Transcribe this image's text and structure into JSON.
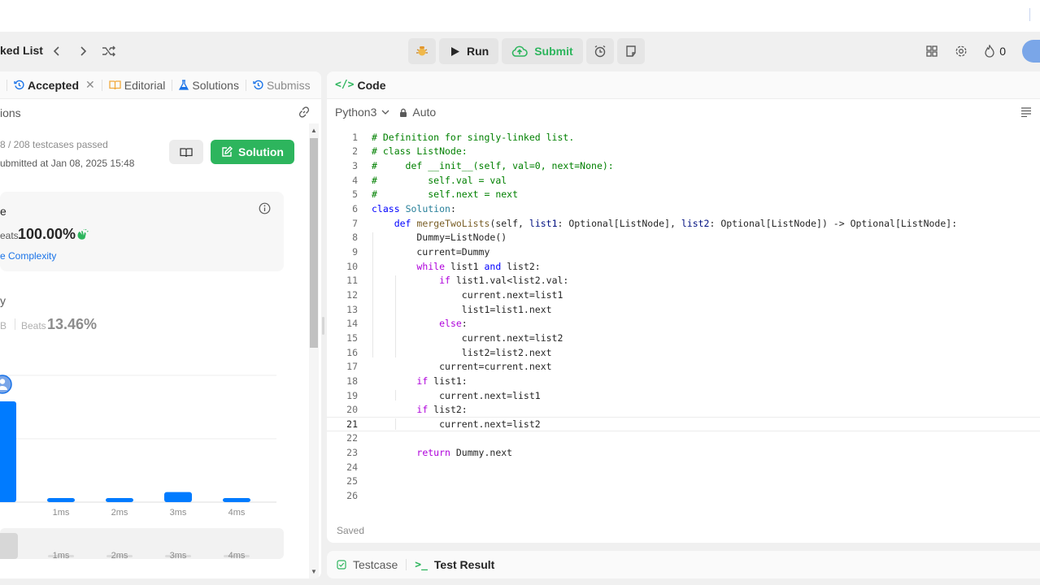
{
  "navbar": {
    "title_fragment": "ked List",
    "run_label": "Run",
    "submit_label": "Submit",
    "streak_count": "0"
  },
  "left_tabs": [
    {
      "label": "Accepted"
    },
    {
      "label": "Editorial"
    },
    {
      "label": "Solutions"
    },
    {
      "label": "Submiss"
    }
  ],
  "submission": {
    "heading_fragment": "ions",
    "testcases": "8 / 208 testcases passed",
    "submitted_at": "ubmitted at Jan 08, 2025 15:48",
    "solution_label": "Solution"
  },
  "runtime": {
    "label_fragment": "e",
    "beats_label": "eats",
    "beats_value": "100.00%",
    "complexity_link": "e Complexity"
  },
  "memory": {
    "label_fragment": "y",
    "unit_fragment": "B",
    "beats_label": "Beats",
    "beats_value": "13.46%"
  },
  "chart_data": {
    "type": "bar",
    "categories": [
      "",
      "1ms",
      "2ms",
      "3ms",
      "4ms"
    ],
    "values": [
      100,
      4,
      4,
      10,
      4
    ],
    "minimap_labels": [
      "1ms",
      "2ms",
      "3ms",
      "4ms"
    ],
    "bar_color": "#007bff"
  },
  "editor": {
    "header_label": "Code",
    "language": "Python3",
    "mode": "Auto",
    "saved_label": "Saved",
    "current_line": 21,
    "lines": [
      "# Definition for singly-linked list.",
      "# class ListNode:",
      "#     def __init__(self, val=0, next=None):",
      "#         self.val = val",
      "#         self.next = next",
      "class Solution:",
      "    def mergeTwoLists(self, list1: Optional[ListNode], list2: Optional[ListNode]) -> Optional[ListNode]:",
      "        Dummy=ListNode()",
      "        current=Dummy",
      "        while list1 and list2:",
      "            if list1.val<list2.val:",
      "                current.next=list1",
      "                list1=list1.next",
      "            else:",
      "                current.next=list2",
      "                list2=list2.next",
      "            current=current.next",
      "        if list1:",
      "            current.next=list1",
      "        if list2:",
      "            current.next=list2",
      "",
      "        return Dummy.next",
      "",
      "",
      ""
    ]
  },
  "bottom_tabs": [
    {
      "label": "Testcase"
    },
    {
      "label": "Test Result"
    }
  ],
  "colors": {
    "accent_green": "#2db55d",
    "accent_blue": "#007bff",
    "link_blue": "#1a73e8"
  }
}
